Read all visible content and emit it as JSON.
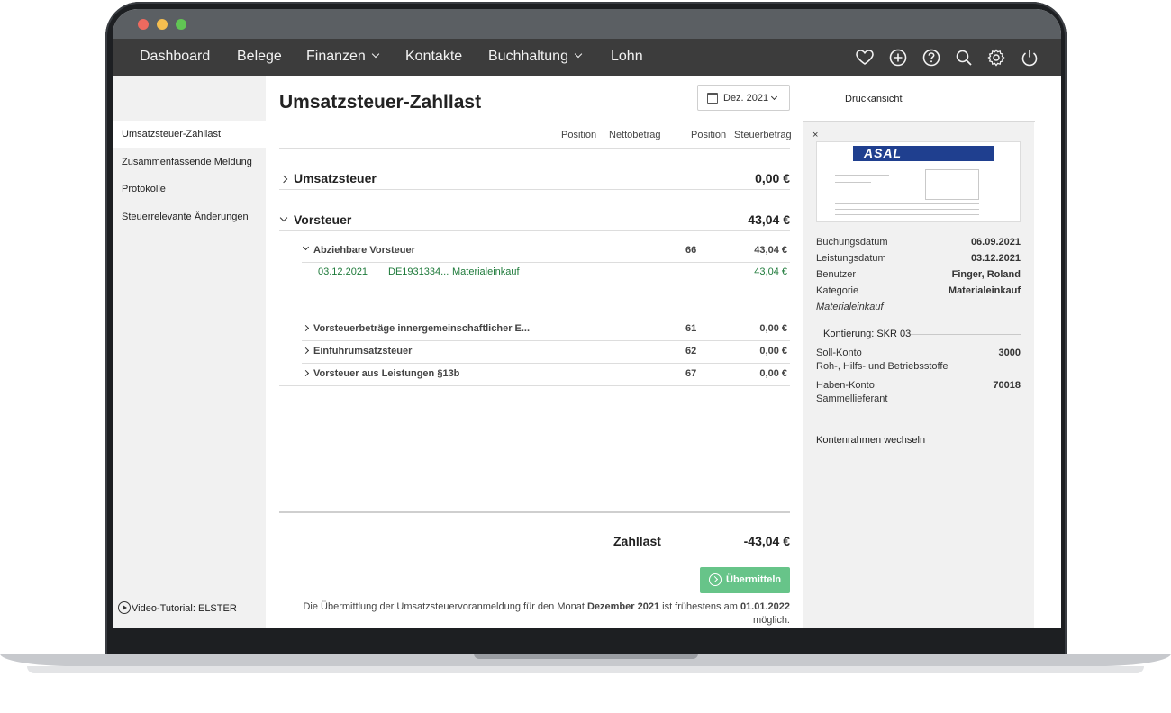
{
  "nav": {
    "items": [
      {
        "label": "Dashboard",
        "dropdown": false
      },
      {
        "label": "Belege",
        "dropdown": false
      },
      {
        "label": "Finanzen",
        "dropdown": true
      },
      {
        "label": "Kontakte",
        "dropdown": false
      },
      {
        "label": "Buchhaltung",
        "dropdown": true
      },
      {
        "label": "Lohn",
        "dropdown": false
      }
    ],
    "icons": [
      "heart-icon",
      "plus-circle-icon",
      "help-icon",
      "search-icon",
      "gear-icon",
      "power-icon"
    ]
  },
  "sidebar": {
    "items": [
      {
        "label": "Umsatzsteuer-Zahllast",
        "active": true
      },
      {
        "label": "Zusammenfassende Meldung",
        "active": false
      },
      {
        "label": "Protokolle",
        "active": false
      },
      {
        "label": "Steuerrelevante Änderungen",
        "active": false
      }
    ],
    "video_link": "Video-Tutorial: ELSTER"
  },
  "main": {
    "title": "Umsatzsteuer-Zahllast",
    "period": "Dez. 2021",
    "columns": [
      "Position",
      "Nettobetrag",
      "Position",
      "Steuerbetrag"
    ],
    "sections": [
      {
        "label": "Umsatzsteuer",
        "value": "0,00 €",
        "expanded": false
      },
      {
        "label": "Vorsteuer",
        "value": "43,04 €",
        "expanded": true
      }
    ],
    "subsections": [
      {
        "label": "Abziehbare Vorsteuer",
        "position": "66",
        "value": "43,04 €",
        "expanded": true
      },
      {
        "label": "Vorsteuerbeträge innergemeinschaftlicher E...",
        "position": "61",
        "value": "0,00 €",
        "expanded": false
      },
      {
        "label": "Einfuhrumsatzsteuer",
        "position": "62",
        "value": "0,00 €",
        "expanded": false
      },
      {
        "label": "Vorsteuer aus Leistungen §13b",
        "position": "67",
        "value": "0,00 €",
        "expanded": false
      }
    ],
    "entry": {
      "date": "03.12.2021",
      "number": "DE1931334...",
      "category": "Materialeinkauf",
      "value": "43,04 €"
    },
    "zahllast_label": "Zahllast",
    "zahllast_value": "-43,04 €",
    "submit_label": "Übermitteln",
    "note_prefix": "Die Übermittlung der Umsatzsteuervoranmeldung für den Monat ",
    "note_month": "Dezember 2021",
    "note_middle": " ist frühestens am ",
    "note_date": "01.01.2022",
    "note_suffix": "möglich."
  },
  "panel": {
    "print_label": "Druckansicht",
    "close_label": "×",
    "thumbnail_logo": "ASAL",
    "details": [
      {
        "label": "Buchungsdatum",
        "value": "06.09.2021"
      },
      {
        "label": "Leistungsdatum",
        "value": "03.12.2021"
      },
      {
        "label": "Benutzer",
        "value": "Finger, Roland"
      },
      {
        "label": "Kategorie",
        "value": "Materialeinkauf"
      }
    ],
    "category_italic": "Materialeinkauf",
    "kontierung_label": "Kontierung: SKR 03",
    "soll": {
      "label": "Soll-Konto",
      "sub": "Roh-, Hilfs- und Betriebsstoffe",
      "value": "3000"
    },
    "haben": {
      "label": "Haben-Konto",
      "sub": "Sammellieferant",
      "value": "70018"
    },
    "kontenrahmen_link": "Kontenrahmen wechseln"
  },
  "colors": {
    "nav_bg": "#3c3c3c",
    "accent_green": "#67c489",
    "entry_green": "#1e7a3a",
    "panel_bg": "#f1f1f1"
  }
}
